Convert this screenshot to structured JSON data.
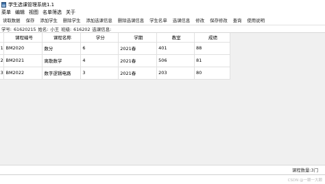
{
  "window": {
    "title": "学生选课管理系统1.1"
  },
  "menu": {
    "items": [
      "菜单",
      "编辑",
      "视图",
      "名单筛选",
      "关于"
    ]
  },
  "toolbar": {
    "buttons": [
      "读取数据",
      "保存",
      "添加学生",
      "删除学生",
      "添加选课信息",
      "删除选课信息",
      "学生名单",
      "选课信息",
      "修改",
      "保存修改",
      "查询",
      "使用说明"
    ]
  },
  "student_info": {
    "id_label": "学号:",
    "id_value": "61620215",
    "name_label": "姓名:",
    "name_value": "小王",
    "class_label": "班级:",
    "class_value": "616202",
    "course_label": "选课信息:"
  },
  "table": {
    "columns": [
      "课程编号",
      "课程名称",
      "学分",
      "学期",
      "教室",
      "成绩"
    ],
    "rows": [
      {
        "num": "1",
        "code": "BM2020",
        "name": "数分",
        "credit": "6",
        "term": "2021春",
        "room": "401",
        "score": "88"
      },
      {
        "num": "2",
        "code": "BM2021",
        "name": "离散数学",
        "credit": "4",
        "term": "2021春",
        "room": "506",
        "score": "81"
      },
      {
        "num": "3",
        "code": "BM2022",
        "name": "数字逻辑电路",
        "credit": "3",
        "term": "2021春",
        "room": "203",
        "score": "80"
      }
    ]
  },
  "status": {
    "course_count": "课程数量:3门"
  },
  "watermark": "CSDN @一颗一大颗"
}
